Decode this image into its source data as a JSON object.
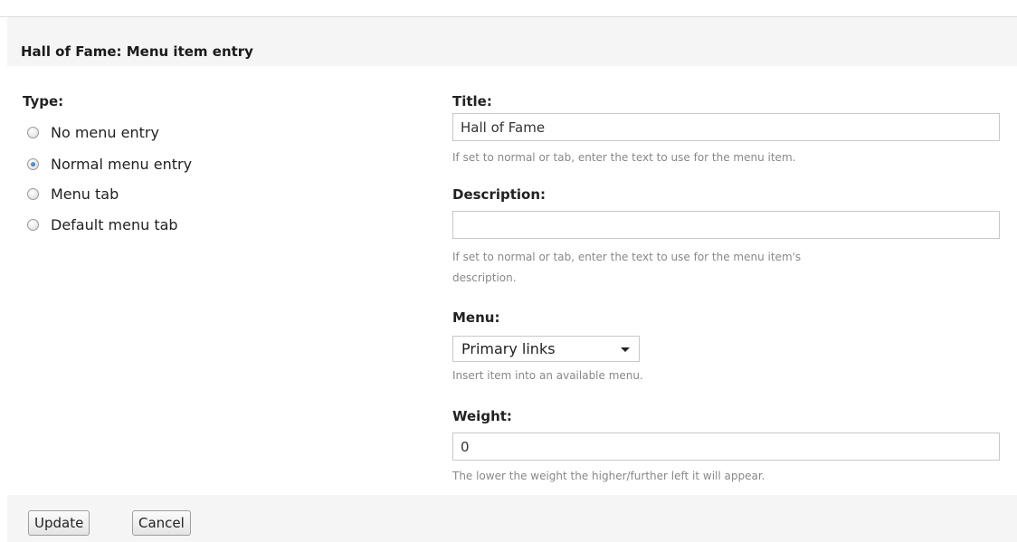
{
  "header": {
    "title": "Hall of Fame: Menu item entry"
  },
  "type": {
    "label": "Type:",
    "options": [
      {
        "label": "No menu entry",
        "checked": false
      },
      {
        "label": "Normal menu entry",
        "checked": true
      },
      {
        "label": "Menu tab",
        "checked": false
      },
      {
        "label": "Default menu tab",
        "checked": false
      }
    ]
  },
  "title_field": {
    "label": "Title:",
    "value": "Hall of Fame",
    "help": "If set to normal or tab, enter the text to use for the menu item."
  },
  "description_field": {
    "label": "Description:",
    "value": "",
    "help_line1": "If set to normal or tab, enter the text to use for the menu item's",
    "help_line2": "description."
  },
  "menu_field": {
    "label": "Menu:",
    "selected": "Primary links",
    "help": "Insert item into an available menu."
  },
  "weight_field": {
    "label": "Weight:",
    "value": "0",
    "help": "The lower the weight the higher/further left it will appear."
  },
  "buttons": {
    "update": "Update",
    "cancel": "Cancel"
  }
}
